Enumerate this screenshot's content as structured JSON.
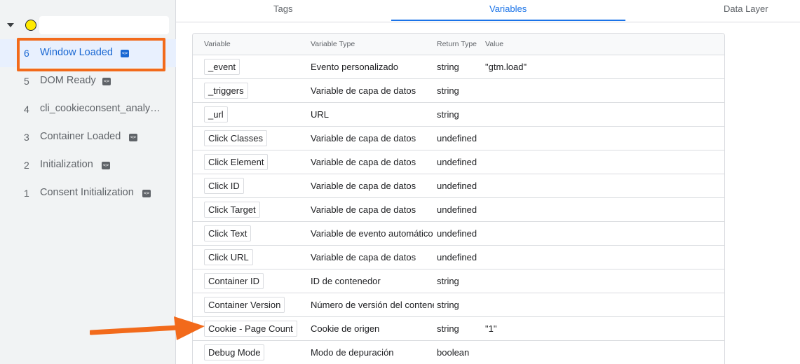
{
  "sidebar": {
    "events": [
      {
        "num": "6",
        "label": "Window Loaded",
        "badge": "<>",
        "active": true
      },
      {
        "num": "5",
        "label": "DOM Ready",
        "badge": "<>"
      },
      {
        "num": "4",
        "label": "cli_cookieconsent_analy…"
      },
      {
        "num": "3",
        "label": "Container Loaded",
        "badge": "<>"
      },
      {
        "num": "2",
        "label": "Initialization",
        "badge": "<>"
      },
      {
        "num": "1",
        "label": "Consent Initialization",
        "badge": "<>"
      }
    ]
  },
  "tabs": {
    "tags": "Tags",
    "variables": "Variables",
    "data_layer": "Data Layer",
    "active": "Variables"
  },
  "table": {
    "headers": {
      "variable": "Variable",
      "type": "Variable Type",
      "return": "Return Type",
      "value": "Value"
    },
    "rows": [
      {
        "variable": "_event",
        "type": "Evento personalizado",
        "return": "string",
        "value": "\"gtm.load\""
      },
      {
        "variable": "_triggers",
        "type": "Variable de capa de datos",
        "return": "string",
        "value": ""
      },
      {
        "variable": "_url",
        "type": "URL",
        "return": "string",
        "value": ""
      },
      {
        "variable": "Click Classes",
        "type": "Variable de capa de datos",
        "return": "undefined",
        "value": ""
      },
      {
        "variable": "Click Element",
        "type": "Variable de capa de datos",
        "return": "undefined",
        "value": ""
      },
      {
        "variable": "Click ID",
        "type": "Variable de capa de datos",
        "return": "undefined",
        "value": ""
      },
      {
        "variable": "Click Target",
        "type": "Variable de capa de datos",
        "return": "undefined",
        "value": ""
      },
      {
        "variable": "Click Text",
        "type": "Variable de evento automático",
        "return": "undefined",
        "value": ""
      },
      {
        "variable": "Click URL",
        "type": "Variable de capa de datos",
        "return": "undefined",
        "value": ""
      },
      {
        "variable": "Container ID",
        "type": "ID de contenedor",
        "return": "string",
        "value": ""
      },
      {
        "variable": "Container Version",
        "type": "Número de versión del contenedor",
        "return": "string",
        "value": ""
      },
      {
        "variable": "Cookie - Page Count",
        "type": "Cookie de origen",
        "return": "string",
        "value": "\"1\""
      },
      {
        "variable": "Debug Mode",
        "type": "Modo de depuración",
        "return": "boolean",
        "value": ""
      }
    ]
  },
  "colors": {
    "accent": "#1a73e8",
    "annotation": "#f26a1b",
    "container_dot": "#ffea00"
  },
  "icons": {
    "expand": "caret-down-icon",
    "container_status": "status-dot-icon",
    "event_badge": "code-icon",
    "annotation_arrow": "arrow-right-icon"
  }
}
